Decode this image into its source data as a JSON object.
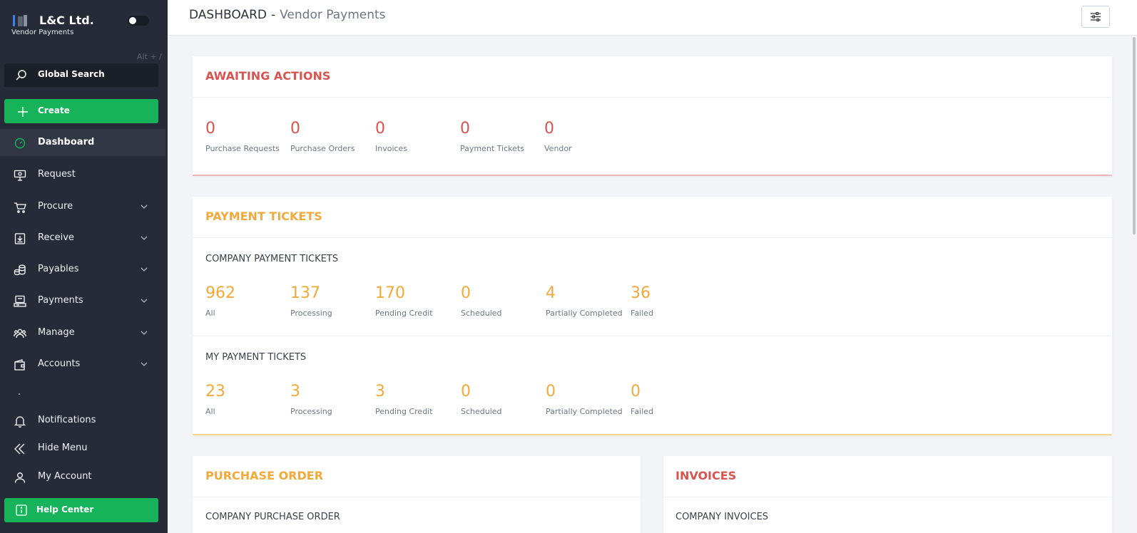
{
  "sidebar": {
    "brand_name": "L&C Ltd.",
    "brand_sub": "Vendor Payments",
    "shortcut_hint": "Alt + /",
    "search_label": "Global Search",
    "create_label": "Create",
    "items": [
      {
        "label": "Dashboard",
        "icon": "dashboard-icon"
      },
      {
        "label": "Request",
        "icon": "request-icon"
      },
      {
        "label": "Procure",
        "icon": "cart-icon"
      },
      {
        "label": "Receive",
        "icon": "receive-icon"
      },
      {
        "label": "Payables",
        "icon": "coins-icon"
      },
      {
        "label": "Payments",
        "icon": "payments-icon"
      },
      {
        "label": "Manage",
        "icon": "users-icon"
      },
      {
        "label": "Accounts",
        "icon": "wallet-icon"
      }
    ],
    "bottom_items": [
      {
        "label": "Notifications",
        "icon": "bell-icon"
      },
      {
        "label": "Hide Menu",
        "icon": "double-chevron-left-icon"
      },
      {
        "label": "My Account",
        "icon": "user-icon"
      }
    ],
    "help_label": "Help Center"
  },
  "header": {
    "title": "DASHBOARD",
    "separator": "-",
    "subtitle": "Vendor Payments"
  },
  "awaiting": {
    "title": "AWAITING ACTIONS",
    "color": "#d9534f",
    "stats": [
      {
        "value": "0",
        "label": "Purchase Requests"
      },
      {
        "value": "0",
        "label": "Purchase Orders"
      },
      {
        "value": "0",
        "label": "Invoices"
      },
      {
        "value": "0",
        "label": "Payment Tickets"
      },
      {
        "value": "0",
        "label": "Vendor"
      }
    ]
  },
  "payment_tickets": {
    "title": "PAYMENT TICKETS",
    "color": "#f2a93b",
    "company_title": "COMPANY PAYMENT TICKETS",
    "company_stats": [
      {
        "value": "962",
        "label": "All"
      },
      {
        "value": "137",
        "label": "Processing"
      },
      {
        "value": "170",
        "label": "Pending Credit"
      },
      {
        "value": "0",
        "label": "Scheduled"
      },
      {
        "value": "4",
        "label": "Partially Completed"
      },
      {
        "value": "36",
        "label": "Failed"
      }
    ],
    "my_title": "MY PAYMENT TICKETS",
    "my_stats": [
      {
        "value": "23",
        "label": "All"
      },
      {
        "value": "3",
        "label": "Processing"
      },
      {
        "value": "3",
        "label": "Pending Credit"
      },
      {
        "value": "0",
        "label": "Scheduled"
      },
      {
        "value": "0",
        "label": "Partially Completed"
      },
      {
        "value": "0",
        "label": "Failed"
      }
    ]
  },
  "purchase_order": {
    "title": "PURCHASE ORDER",
    "section": "COMPANY PURCHASE ORDER"
  },
  "invoices": {
    "title": "INVOICES",
    "section": "COMPANY INVOICES"
  }
}
